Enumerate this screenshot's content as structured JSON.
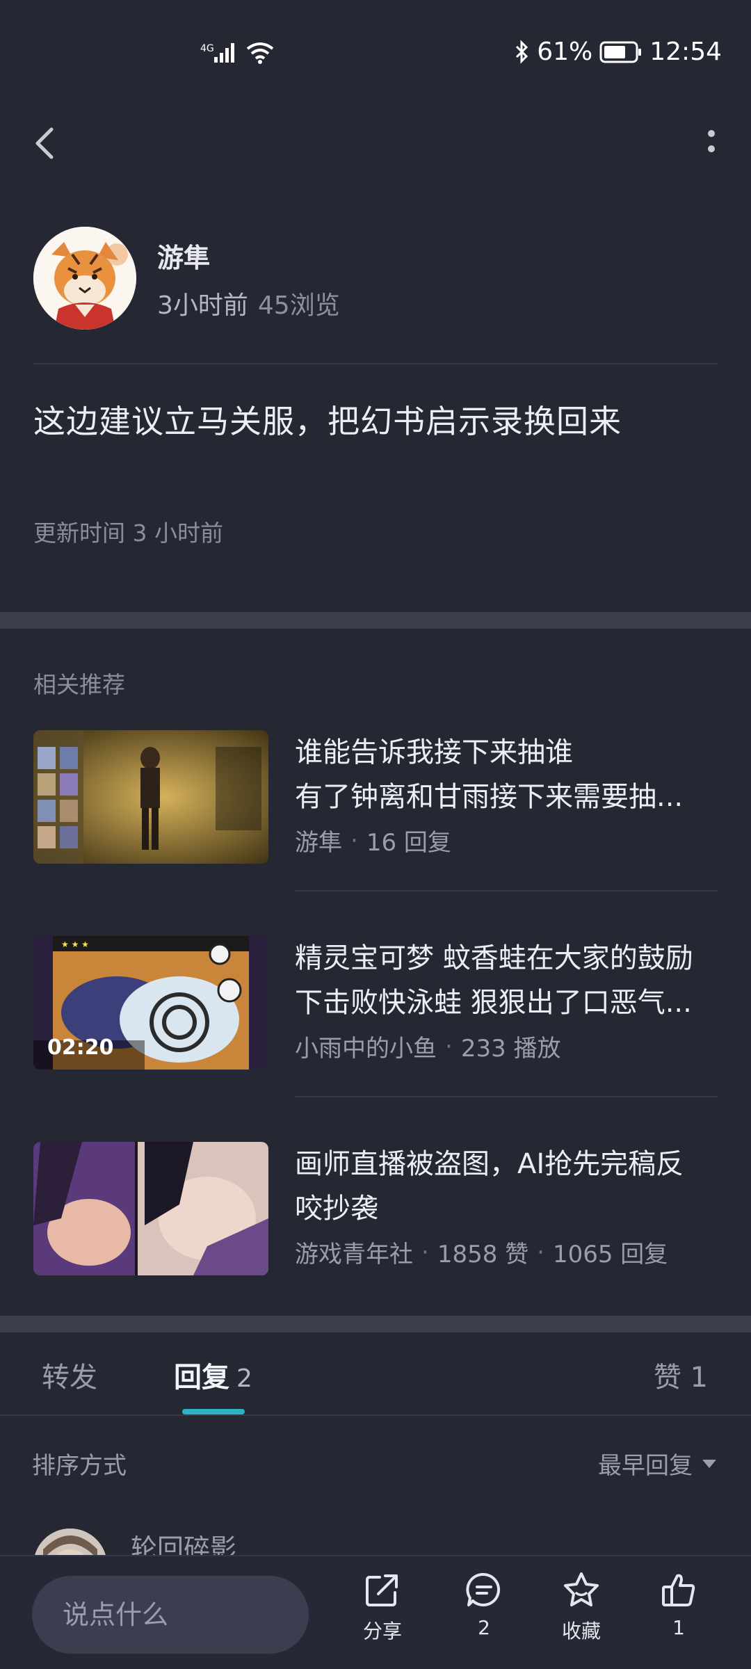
{
  "status_bar": {
    "network": "4G",
    "battery": "61%",
    "time": "12:54"
  },
  "author": {
    "name": "游隼",
    "time_ago": "3小时前",
    "views": "45浏览"
  },
  "post": {
    "text": "这边建议立马关服，把幻书启示录换回来",
    "update_time": "更新时间 3 小时前"
  },
  "recommend": {
    "title": "相关推荐",
    "items": [
      {
        "line1": "谁能告诉我接下来抽谁",
        "line2": "有了钟离和甘雨接下来需要抽...",
        "author": "游隼",
        "stat1": "16 回复",
        "stat2": ""
      },
      {
        "line1": "精灵宝可梦 蚊香蛙在大家的鼓励",
        "line2": "下击败快泳蛙 狠狠出了口恶气...",
        "author": "小雨中的小鱼",
        "stat1": "233 播放",
        "stat2": "",
        "duration": "02:20"
      },
      {
        "line1": "画师直播被盗图，AI抢先完稿反",
        "line2": "咬抄袭",
        "author": "游戏青年社",
        "stat1": "1858 赞",
        "stat2": "1065 回复"
      }
    ]
  },
  "tabs": {
    "repost": "转发",
    "reply": "回复",
    "reply_count": "2",
    "like": "赞 1"
  },
  "sort": {
    "label": "排序方式",
    "value": "最早回复"
  },
  "comment": {
    "name": "轮回碎影"
  },
  "bottom_bar": {
    "placeholder": "说点什么",
    "share": "分享",
    "comments": "2",
    "favorite": "收藏",
    "likes": "1"
  }
}
